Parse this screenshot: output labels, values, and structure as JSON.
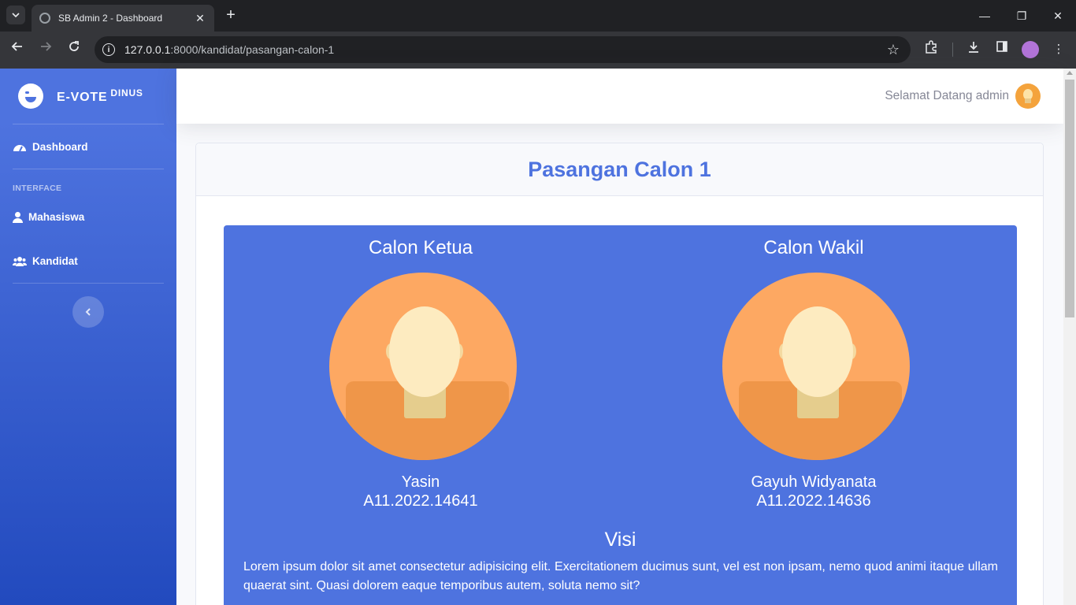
{
  "browser": {
    "tab_title": "SB Admin 2 - Dashboard",
    "url_host": "127.0.0.1",
    "url_path": ":8000/kandidat/pasangan-calon-1"
  },
  "sidebar": {
    "brand": "E-VOTE",
    "brand_sup": "DINUS",
    "dashboard": "Dashboard",
    "heading": "Interface",
    "items": [
      {
        "label": "Mahasiswa",
        "icon": "user-icon"
      },
      {
        "label": "Kandidat",
        "icon": "users-icon"
      }
    ],
    "toggle_icon": "chevron-left-icon"
  },
  "topbar": {
    "greeting": "Selamat Datang admin"
  },
  "card": {
    "title": "Pasangan Calon 1",
    "ketua": {
      "heading": "Calon Ketua",
      "name": "Yasin",
      "nim": "A11.2022.14641"
    },
    "wakil": {
      "heading": "Calon Wakil",
      "name": "Gayuh Widyanata",
      "nim": "A11.2022.14636"
    },
    "visi_heading": "Visi",
    "visi_text": "Lorem ipsum dolor sit amet consectetur adipisicing elit. Exercitationem ducimus sunt, vel est non ipsam, nemo quod animi itaque ullam quaerat sint. Quasi dolorem eaque temporibus autem, soluta nemo sit?"
  },
  "colors": {
    "primary": "#4e73df",
    "portrait_bg": "#fda862"
  }
}
